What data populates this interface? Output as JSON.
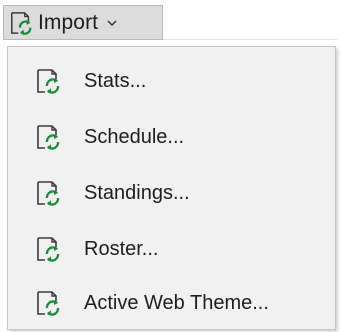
{
  "button": {
    "label": "Import",
    "icon": "import-refresh-icon",
    "chevron": "chevron-down-icon"
  },
  "menu": {
    "items": [
      {
        "label": "Stats...",
        "icon": "import-refresh-icon"
      },
      {
        "label": "Schedule...",
        "icon": "import-refresh-icon"
      },
      {
        "label": "Standings...",
        "icon": "import-refresh-icon"
      },
      {
        "label": "Roster...",
        "icon": "import-refresh-icon"
      },
      {
        "label": "Active Web Theme...",
        "icon": "import-refresh-icon"
      }
    ]
  },
  "colors": {
    "icon_green": "#1f8b3c",
    "icon_outline": "#3c3c3c",
    "button_bg": "#dcdcdc",
    "menu_bg": "#f1f1f1"
  }
}
